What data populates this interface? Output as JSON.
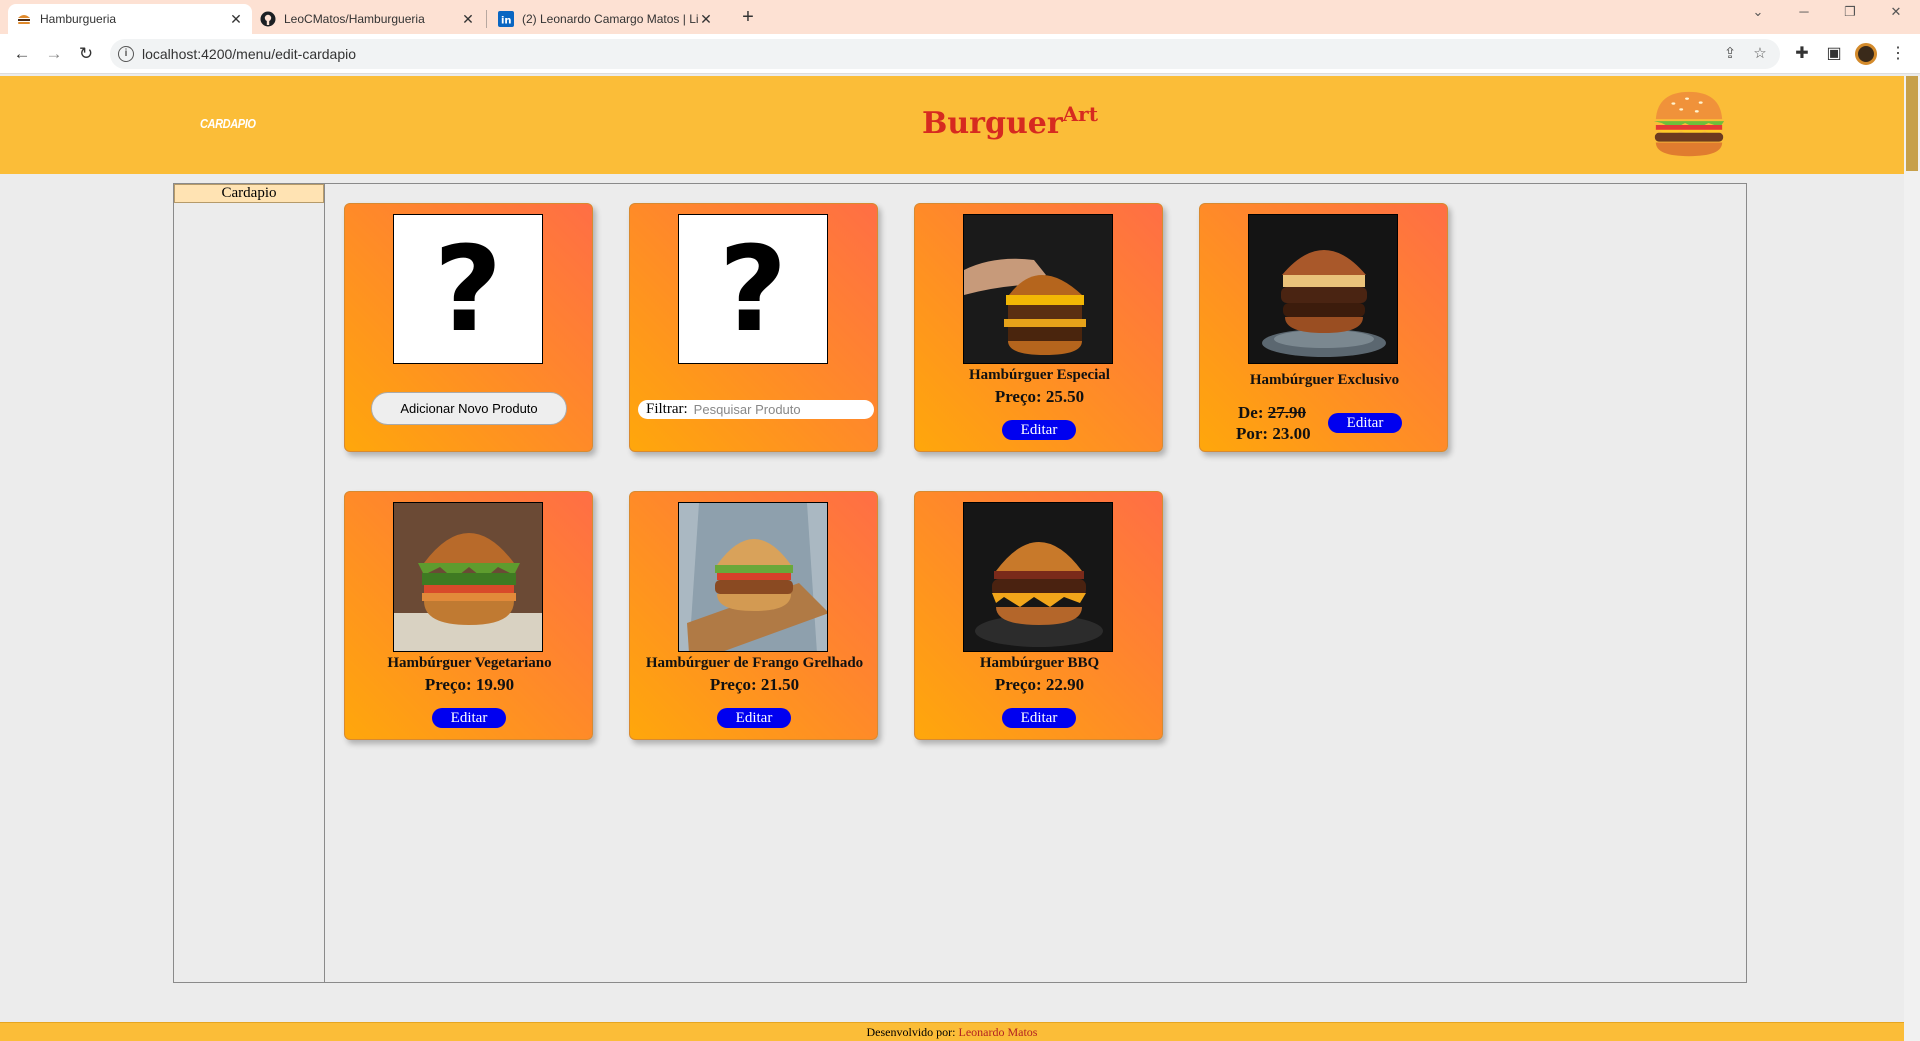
{
  "browser": {
    "tabs": [
      {
        "title": "Hamburgueria",
        "icon": "burger-favicon"
      },
      {
        "title": "LeoCMatos/Hamburgueria",
        "icon": "github-icon"
      },
      {
        "title": "(2) Leonardo Camargo Matos | Li",
        "icon": "linkedin-icon"
      }
    ],
    "new_tab": "+",
    "url": "localhost:4200/menu/edit-cardapio"
  },
  "header": {
    "nav_link": "CARDAPIO",
    "brand_main": "Burguer",
    "brand_sup": "Art",
    "color": "#fbbd38"
  },
  "sidebar": {
    "items": [
      {
        "label": "Cardapio"
      }
    ]
  },
  "controls": {
    "add_button": "Adicionar Novo Produto",
    "filter_label": "Filtrar:",
    "filter_placeholder": "Pesquisar Produto",
    "placeholder_glyph": "?"
  },
  "products": [
    {
      "name": "Hambúrguer Especial",
      "price": "Preço: 25.50",
      "edit": "Editar"
    },
    {
      "name": "Hambúrguer Exclusivo",
      "old_price_label": "De:",
      "old_price": "27.90",
      "new_price": "Por: 23.00",
      "edit": "Editar"
    },
    {
      "name": "Hambúrguer Vegetariano",
      "price": "Preço: 19.90",
      "edit": "Editar"
    },
    {
      "name": "Hambúrguer de Frango Grelhado",
      "price": "Preço: 21.50",
      "edit": "Editar"
    },
    {
      "name": "Hambúrguer BBQ",
      "price": "Preço: 22.90",
      "edit": "Editar"
    }
  ],
  "footer": {
    "credit_prefix": "Desenvolvido por:",
    "credit_author": "Leonardo Matos"
  },
  "colors": {
    "accent": "#fbbd38",
    "brand": "#d62a20",
    "edit_button": "#0000f0",
    "card_gradient_start": "#ffa70b",
    "card_gradient_end": "#ff6e45"
  }
}
